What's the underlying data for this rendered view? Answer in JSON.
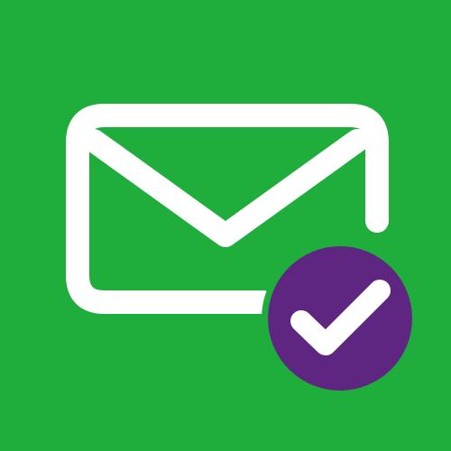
{
  "icon": {
    "name": "mail-verified-icon",
    "glyphs": [
      "envelope-icon",
      "checkmark-icon"
    ]
  },
  "colors": {
    "background": "#1fad3c",
    "envelope_stroke": "#ffffff",
    "badge_fill": "#5e2680",
    "badge_ring": "#1fad3c",
    "check_stroke": "#ffffff"
  }
}
